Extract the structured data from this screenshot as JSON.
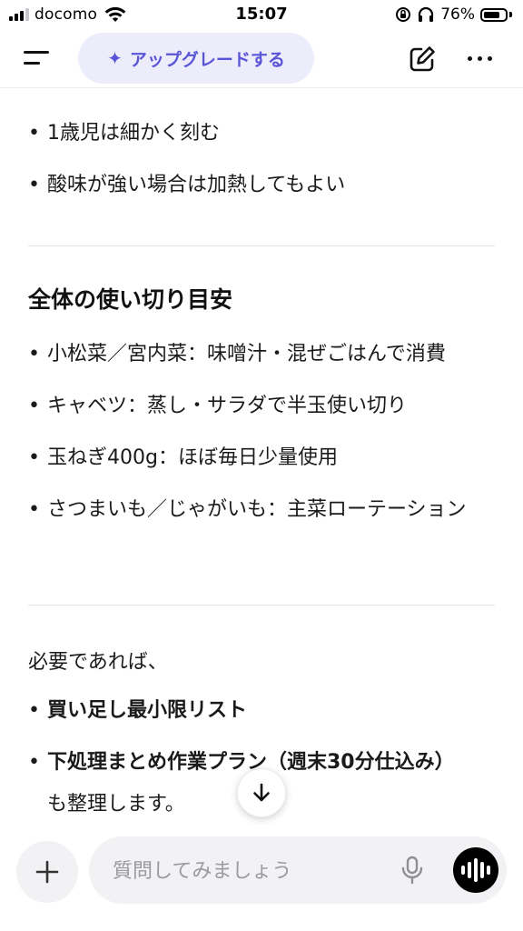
{
  "status_bar": {
    "carrier": "docomo",
    "time": "15:07",
    "battery_percent": "76%",
    "battery_level": 0.76
  },
  "header": {
    "upgrade_icon": "✦",
    "upgrade_label": "アップグレードする"
  },
  "content": {
    "top_bullets": [
      "1歳児は細かく刻む",
      "酸味が強い場合は加熱してもよい"
    ],
    "section_title": "全体の使い切り目安",
    "section_bullets": [
      "小松菜／宮内菜：味噌汁・混ぜごはんで消費",
      "キャベツ：蒸し・サラダで半玉使い切り",
      "玉ねぎ400g：ほぼ毎日少量使用",
      "さつまいも／じゃがいも：主菜ローテーション"
    ],
    "intro_text": "必要であれば、",
    "bold_bullets": [
      "買い足し最小限リスト",
      "下処理まとめ作業プラン（週末30分仕込み）"
    ],
    "closing_text": "も整理します。"
  },
  "composer": {
    "placeholder": "質問してみましょう",
    "value": ""
  },
  "colors": {
    "accent": "#5a55d6",
    "accent_bg": "#ececfb",
    "input_bg": "#f2f2f4"
  }
}
